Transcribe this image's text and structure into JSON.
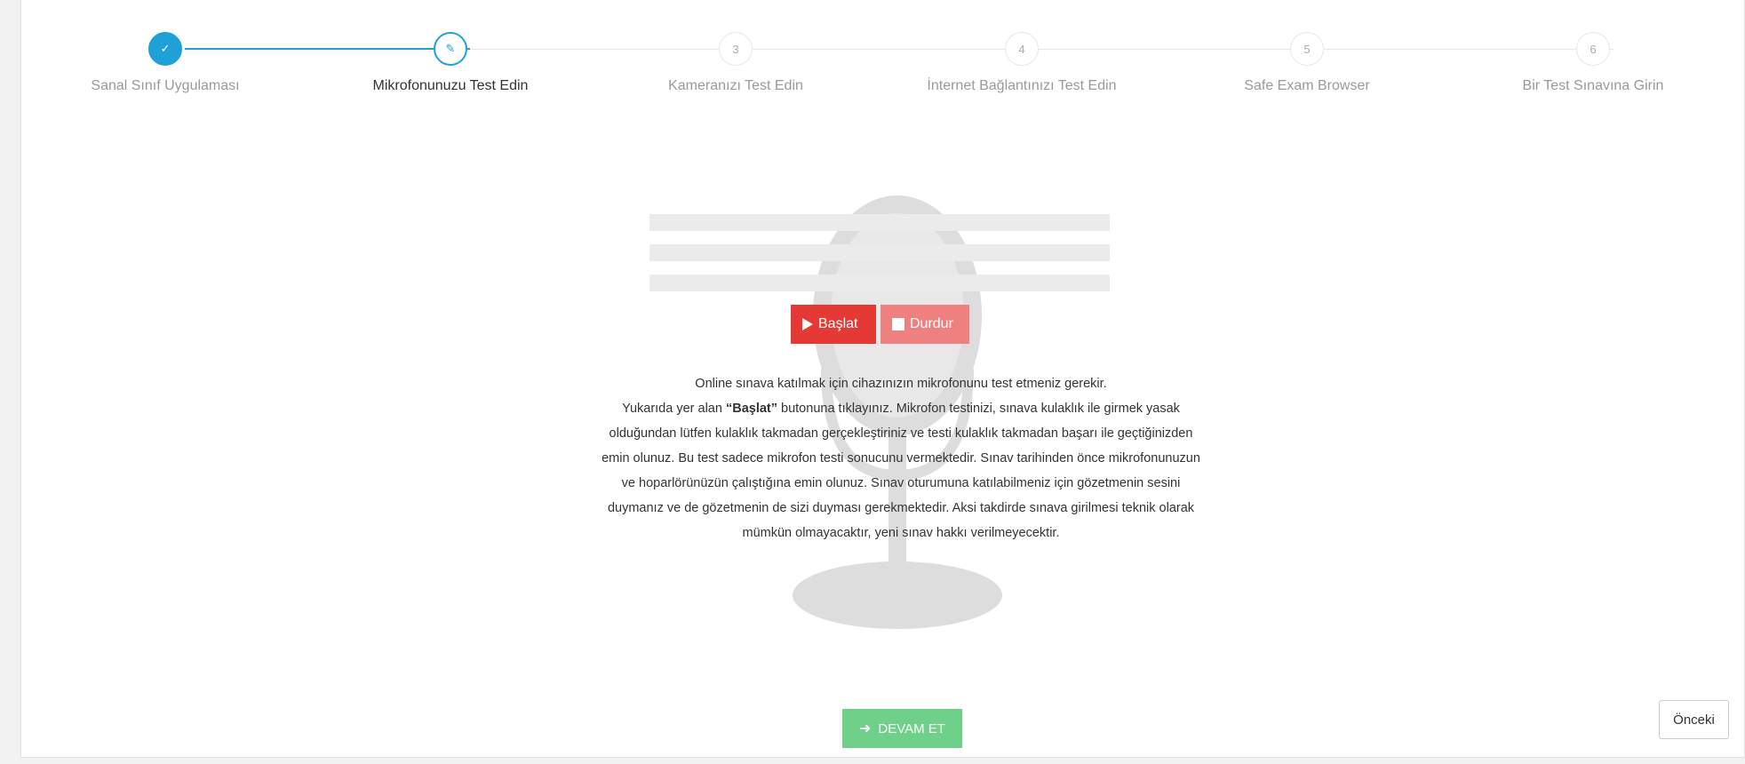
{
  "steps": [
    {
      "number": "✓",
      "label": "Sanal Sınıf Uygulaması",
      "state": "done"
    },
    {
      "number": "✎",
      "label": "Mikrofonunuzu Test Edin",
      "state": "active"
    },
    {
      "number": "3",
      "label": "Kameranızı Test Edin",
      "state": "pending"
    },
    {
      "number": "4",
      "label": "İnternet Bağlantınızı Test Edin",
      "state": "pending"
    },
    {
      "number": "5",
      "label": "Safe Exam Browser",
      "state": "pending"
    },
    {
      "number": "6",
      "label": "Bir Test Sınavına Girin",
      "state": "pending"
    }
  ],
  "controls": {
    "start_label": "Başlat",
    "stop_label": "Durdur"
  },
  "info": {
    "line1": "Online sınava katılmak için cihazınızın mikrofonunu test etmeniz gerekir.",
    "pre_bold": "Yukarıda yer alan ",
    "bold": "“Başlat”",
    "post_bold": " butonuna tıklayınız. Mikrofon testinizi, sınava kulaklık ile girmek yasak olduğundan lütfen kulaklık takmadan gerçekleştiriniz ve testi kulaklık takmadan başarı ile geçtiğinizden emin olunuz. Bu test sadece mikrofon testi sonucunu vermektedir. Sınav tarihinden önce mikrofonunuzun ve hoparlörünüzün çalıştığına emin olunuz. Sınav oturumuna katılabilmeniz için gözetmenin sesini duymanız ve de gözetmenin de sizi duyması gerekmektedir. Aksi takdirde sınava girilmesi teknik olarak mümkün olmayacaktır, yeni sınav hakkı verilmeyecektir."
  },
  "footer": {
    "continue_label": "DEVAM ET",
    "previous_label": "Önceki"
  },
  "colors": {
    "accent": "#1ea1d7",
    "start": "#e53935",
    "stop": "#ef8080",
    "continue": "#6fd089"
  }
}
